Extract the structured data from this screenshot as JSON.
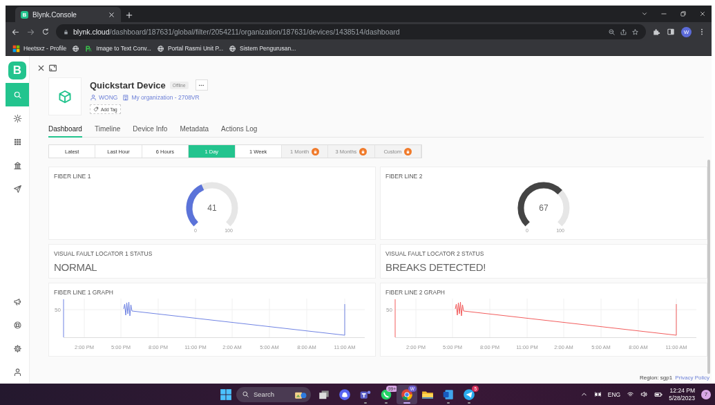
{
  "browser": {
    "tabs": [
      {
        "favicon": "B",
        "title": "Blynk.Console",
        "selected": true
      }
    ],
    "url": {
      "host": "blynk.cloud",
      "path": "/dashboard/187631/global/filter/2054211/organization/187631/devices/1438514/dashboard"
    },
    "profile": "W",
    "bookmarks": [
      {
        "kind": "windows",
        "label": "Heetsxz - Profile"
      },
      {
        "kind": "globe"
      },
      {
        "kind": "app",
        "label": "Image to Text Conv..."
      },
      {
        "kind": "globe",
        "label": "Portal Rasmi Unit P..."
      },
      {
        "kind": "globe",
        "label": "Sistem Pengurusan..."
      }
    ]
  },
  "sidebar": {
    "logo": "B",
    "items": [
      {
        "kind": "search",
        "selected": true
      },
      {
        "kind": "sun",
        "selected": false
      },
      {
        "kind": "grid",
        "selected": false
      },
      {
        "kind": "building",
        "selected": false
      },
      {
        "kind": "send",
        "selected": false
      }
    ],
    "bottom_items": [
      {
        "kind": "megaphone",
        "selected": false
      },
      {
        "kind": "lifebuoy",
        "selected": false
      },
      {
        "kind": "gear",
        "selected": false
      },
      {
        "kind": "person",
        "selected": false
      }
    ]
  },
  "device": {
    "name": "Quickstart Device",
    "status": "Offline",
    "owner": "WONG",
    "organization": "My organization - 2708VR",
    "add_tag": "Add Tag"
  },
  "tabs": [
    {
      "label": "Dashboard",
      "selected": true
    },
    {
      "label": "Timeline",
      "selected": false
    },
    {
      "label": "Device Info",
      "selected": false
    },
    {
      "label": "Metadata",
      "selected": false
    },
    {
      "label": "Actions Log",
      "selected": false
    }
  ],
  "time_ranges": [
    {
      "label": "Latest",
      "selected": false,
      "locked": false
    },
    {
      "label": "Last Hour",
      "selected": false,
      "locked": false
    },
    {
      "label": "6 Hours",
      "selected": false,
      "locked": false
    },
    {
      "label": "1 Day",
      "selected": true,
      "locked": false
    },
    {
      "label": "1 Week",
      "selected": false,
      "locked": false
    },
    {
      "label": "1 Month",
      "selected": false,
      "locked": true
    },
    {
      "label": "3 Months",
      "selected": false,
      "locked": true
    },
    {
      "label": "Custom",
      "selected": false,
      "locked": true
    }
  ],
  "widgets": [
    {
      "kind": "gauge",
      "title": "FIBER LINE 1",
      "value": "41",
      "min": "0",
      "max": "100",
      "color": "#5b73d9"
    },
    {
      "kind": "gauge",
      "title": "FIBER LINE 2",
      "value": "67",
      "min": "0",
      "max": "100",
      "color": "#444444"
    },
    {
      "kind": "status",
      "title": "VISUAL FAULT LOCATOR 1 STATUS",
      "value": "NORMAL"
    },
    {
      "kind": "status",
      "title": "VISUAL FAULT LOCATOR 2 STATUS",
      "value": "BREAKS DETECTED!"
    },
    {
      "kind": "graph",
      "title": "FIBER LINE 1 GRAPH",
      "y_tick": "50",
      "x_ticks": [
        "2:00 PM",
        "5:00 PM",
        "8:00 PM",
        "11:00 PM",
        "2:00 AM",
        "5:00 AM",
        "8:00 AM",
        "11:00 AM"
      ],
      "color": "#6f83e3"
    },
    {
      "kind": "graph",
      "title": "FIBER LINE 2 GRAPH",
      "y_tick": "50",
      "x_ticks": [
        "2:00 PM",
        "5:00 PM",
        "8:00 PM",
        "11:00 PM",
        "2:00 AM",
        "5:00 AM",
        "8:00 AM",
        "11:00 AM"
      ],
      "color": "#f25c5c"
    }
  ],
  "footer": {
    "region": "Region: sgp1",
    "privacy": "Privacy Policy"
  },
  "taskbar": {
    "search": "Search",
    "apps": [
      {
        "kind": "taskview",
        "open": false,
        "active": false
      },
      {
        "kind": "discord",
        "open": false,
        "active": false
      },
      {
        "kind": "teams",
        "open": true,
        "active": false
      },
      {
        "kind": "whatsapp",
        "open": true,
        "active": false,
        "badge": "99+"
      },
      {
        "kind": "chrome",
        "open": true,
        "active": true,
        "badge": "W"
      },
      {
        "kind": "explorer",
        "open": false,
        "active": false
      },
      {
        "kind": "word",
        "open": true,
        "active": false
      },
      {
        "kind": "telegram",
        "open": true,
        "active": false,
        "badge": "5"
      }
    ],
    "language": "ENG",
    "time": "12:24 PM",
    "date": "5/28/2023",
    "notifications": "7"
  }
}
